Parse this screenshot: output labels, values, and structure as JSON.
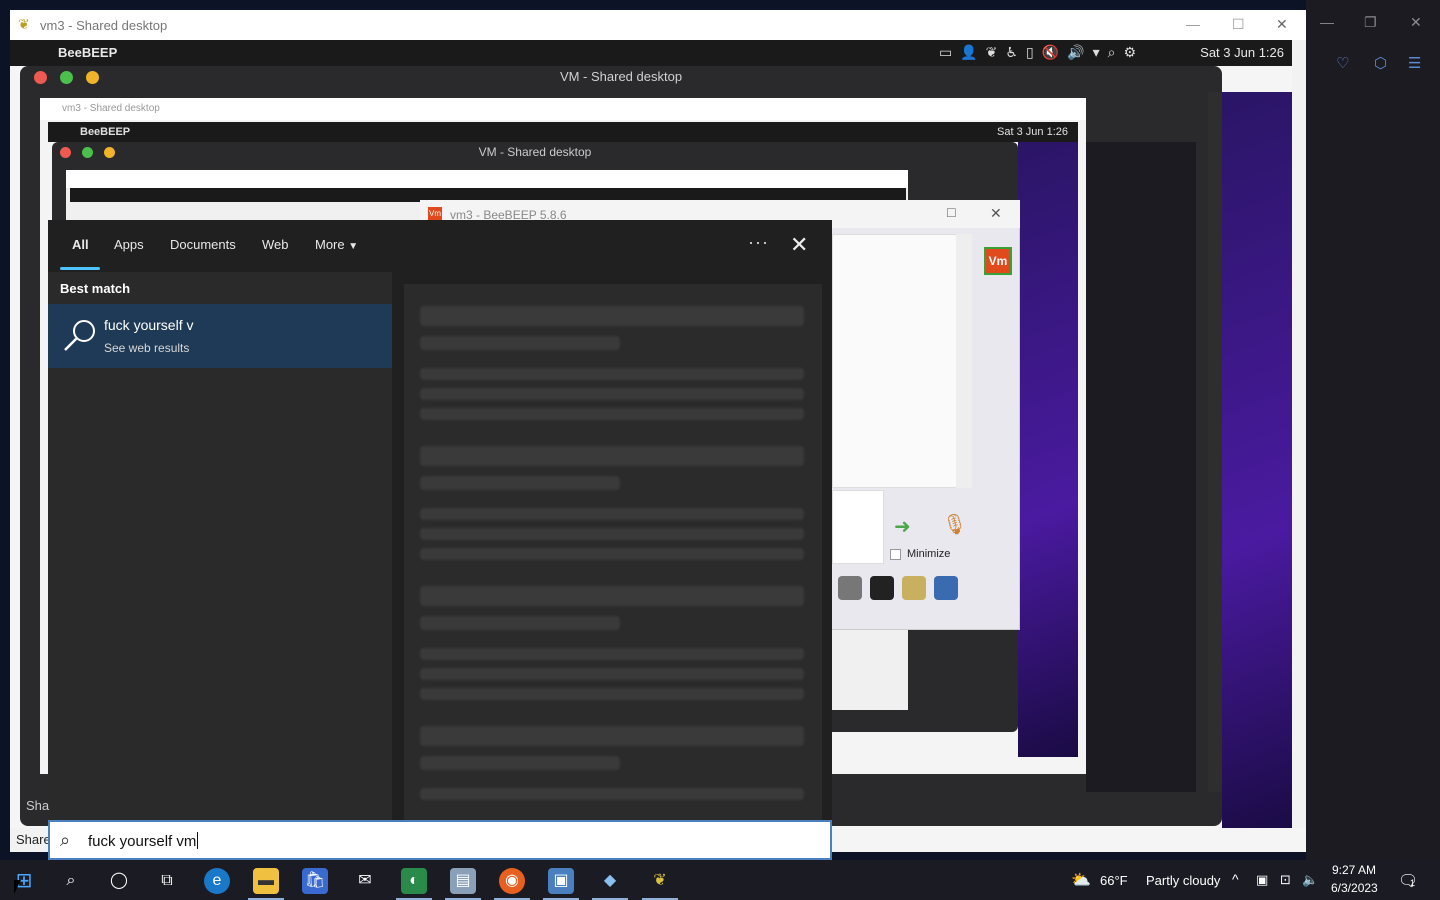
{
  "outer_window": {
    "title": "vm3 - Shared desktop"
  },
  "mac_menubar": {
    "app": "BeeBEEP",
    "clock": "Sat 3 Jun 1:26"
  },
  "mac_window": {
    "title": "VM - Shared desktop"
  },
  "nested": {
    "outer_title": "vm3 - Shared desktop",
    "mac_app": "BeeBEEP",
    "mac_clock": "Sat 3 Jun 1:26",
    "mac_title": "VM - Shared desktop"
  },
  "beebeep": {
    "title": "vm3 - BeeBEEP 5.8.6",
    "avatar": "Vm",
    "minimize_label": "Minimize"
  },
  "search": {
    "tabs": [
      "All",
      "Apps",
      "Documents",
      "Web",
      "More"
    ],
    "more_dots": "···",
    "section_label": "Best match",
    "result_title": "fuck yourself v",
    "result_subtitle": "See web results",
    "query": "fuck yourself vm"
  },
  "shared_labels": {
    "left_cut": "Sha",
    "left_tab": "Share"
  },
  "taskbar": {
    "weather_temp": "66°F",
    "weather_desc": "Partly cloudy",
    "time": "9:27 AM",
    "date": "6/3/2023",
    "notification_count": "1"
  },
  "colors": {
    "accent": "#4cc2ff",
    "result_highlight": "#1f3a56",
    "search_bg": "#202020",
    "taskbar_bg": "#1b1b24"
  }
}
